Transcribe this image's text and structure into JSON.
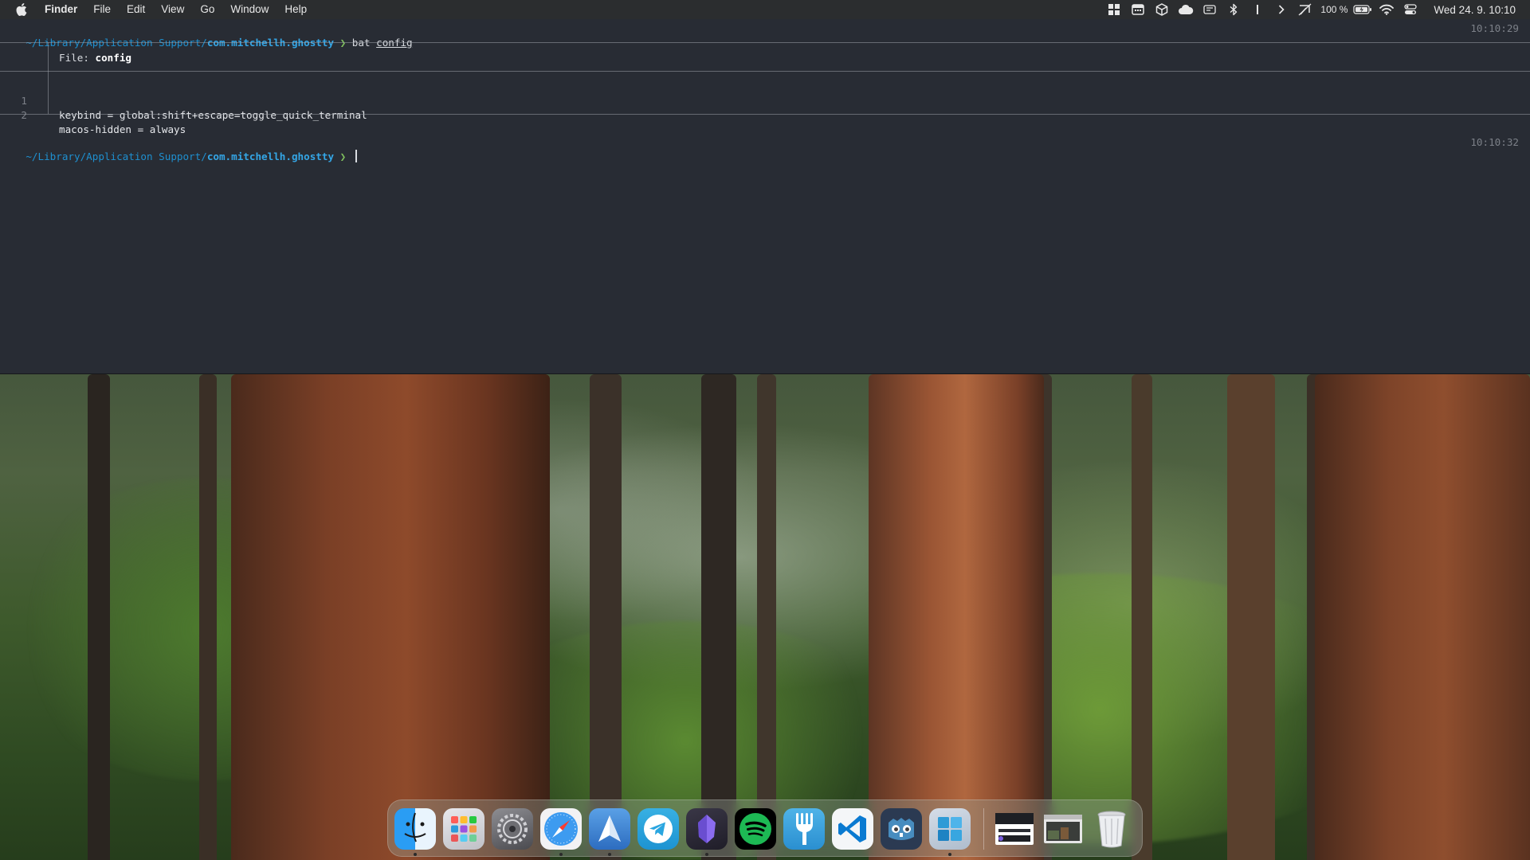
{
  "menubar": {
    "app_name": "Finder",
    "items": [
      "File",
      "Edit",
      "View",
      "Go",
      "Window",
      "Help"
    ],
    "battery_text": "100 %",
    "clock": "Wed 24. 9.  10:10"
  },
  "terminal": {
    "prompt1": {
      "path_prefix": "~/Library/Application Support/",
      "path_bold": "com.mitchellh.ghostty",
      "arrow": " ❯ ",
      "command": "bat ",
      "argument": "config",
      "time": "10:10:29"
    },
    "bat": {
      "header_label": "File: ",
      "header_file": "config",
      "lines": [
        {
          "num": "1",
          "code": "keybind = global:shift+escape=toggle_quick_terminal"
        },
        {
          "num": "2",
          "code": "macos-hidden = always"
        }
      ]
    },
    "prompt2": {
      "path_prefix": "~/Library/Application Support/",
      "path_bold": "com.mitchellh.ghostty",
      "arrow": " ❯ ",
      "time": "10:10:32"
    }
  },
  "dock": {
    "apps": [
      {
        "name": "finder-icon",
        "running": true
      },
      {
        "name": "launchpad-icon",
        "running": false
      },
      {
        "name": "system-settings-icon",
        "running": false
      },
      {
        "name": "safari-icon",
        "running": true
      },
      {
        "name": "spark-mail-icon",
        "running": true
      },
      {
        "name": "telegram-icon",
        "running": false
      },
      {
        "name": "obsidian-icon",
        "running": true
      },
      {
        "name": "spotify-icon",
        "running": false
      },
      {
        "name": "fork-icon",
        "running": false
      },
      {
        "name": "vscode-icon",
        "running": false
      },
      {
        "name": "godot-icon",
        "running": false
      },
      {
        "name": "windows-app-icon",
        "running": true
      },
      {
        "name": "minimized-window-1-icon",
        "running": false
      },
      {
        "name": "minimized-window-2-icon",
        "running": false
      },
      {
        "name": "trash-icon",
        "running": false
      }
    ],
    "colors": {
      "finder": "#2a9df4",
      "spotify": "#1db954",
      "vscode": "#0a7ad1",
      "telegram": "#2aa6e0",
      "godot": "#478cbf"
    }
  }
}
